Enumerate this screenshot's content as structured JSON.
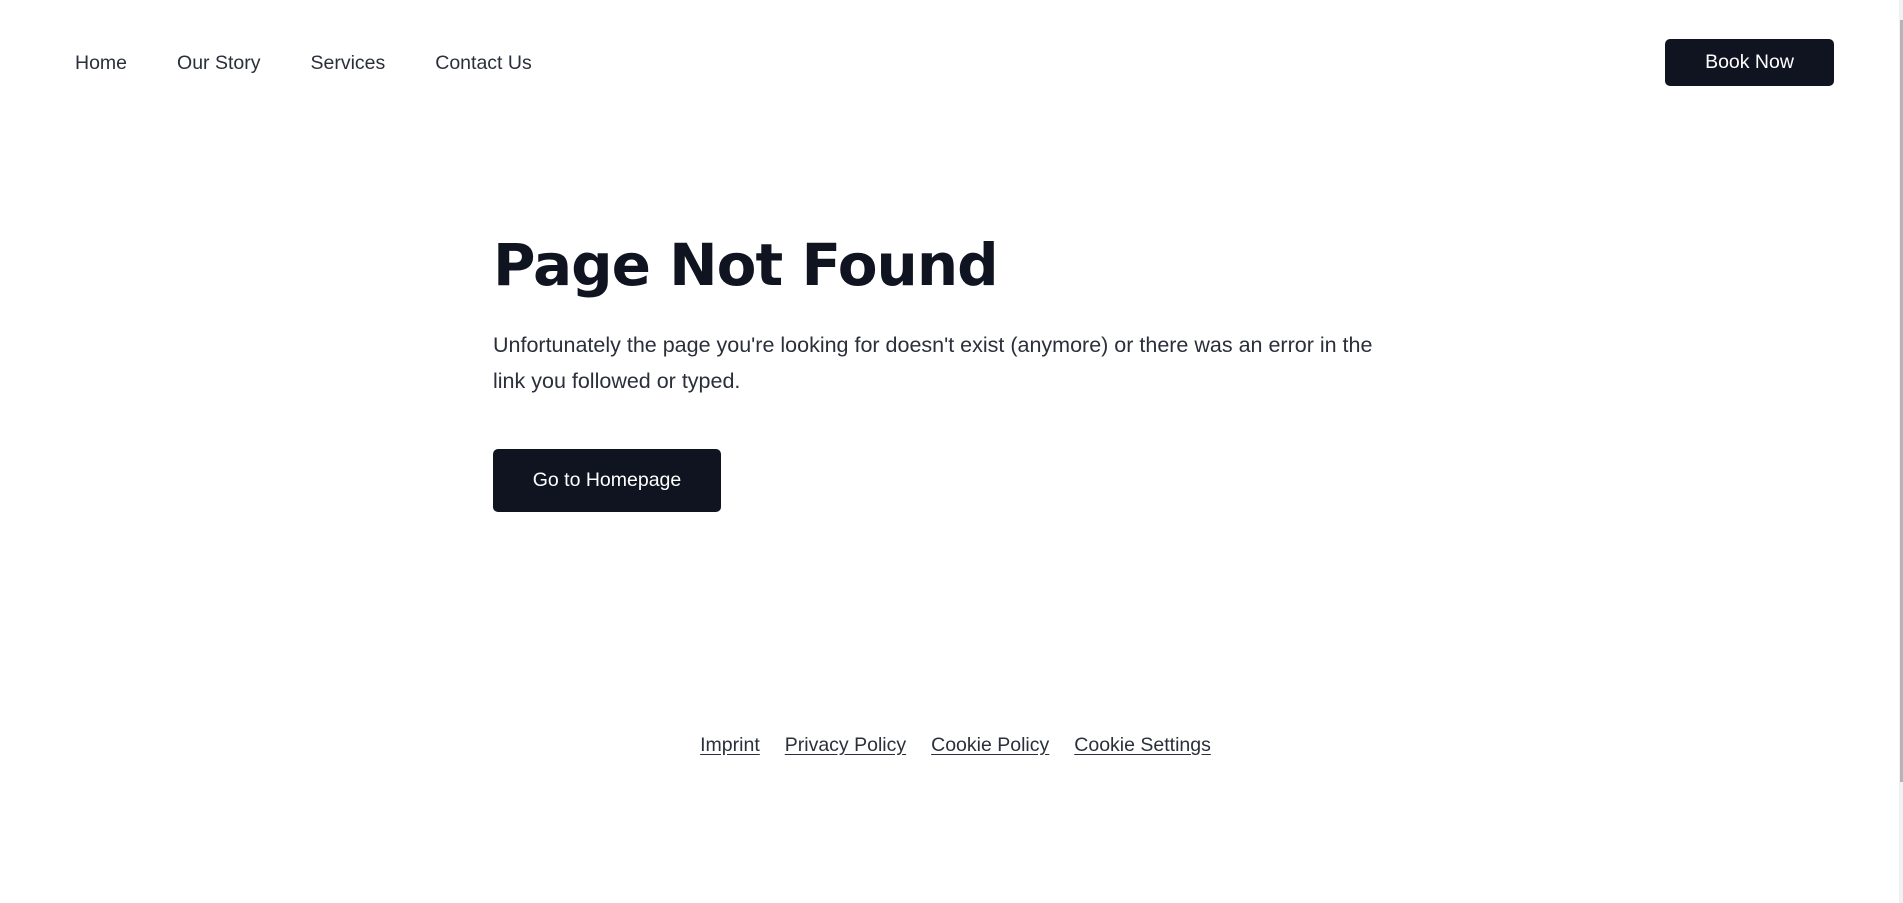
{
  "header": {
    "nav": [
      {
        "label": "Home"
      },
      {
        "label": "Our Story"
      },
      {
        "label": "Services"
      },
      {
        "label": "Contact Us"
      }
    ],
    "cta_label": "Book Now"
  },
  "main": {
    "title": "Page Not Found",
    "description": "Unfortunately the page you're looking for doesn't exist (anymore) or there was an error in the link you followed or typed.",
    "button_label": "Go to Homepage"
  },
  "footer": {
    "links": [
      {
        "label": "Imprint"
      },
      {
        "label": "Privacy Policy"
      },
      {
        "label": "Cookie Policy"
      },
      {
        "label": "Cookie Settings"
      }
    ]
  },
  "colors": {
    "primary": "#0f1420",
    "text": "#2a2f3a",
    "background": "#ffffff"
  }
}
